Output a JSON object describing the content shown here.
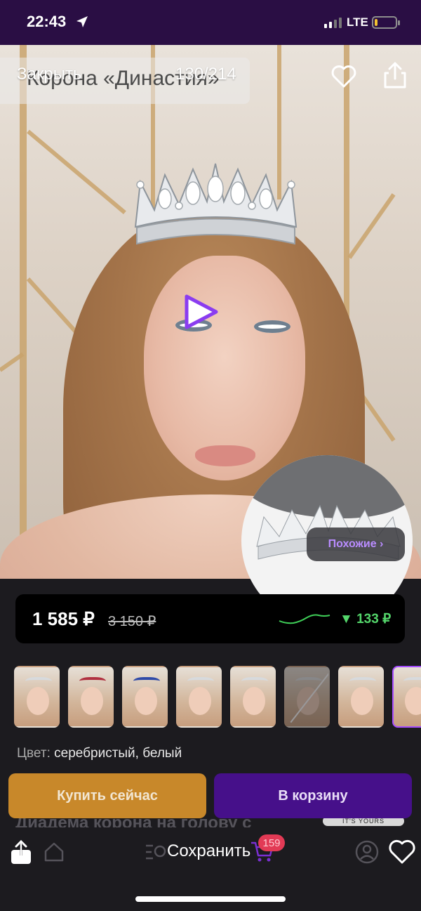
{
  "status_bar": {
    "time": "22:43",
    "network": "LTE",
    "battery_level": 0.15
  },
  "photo": {
    "title": "Корона «Династия»",
    "close_label": "Закрыть",
    "counter": "130/214",
    "similar_label": "Похожие ›"
  },
  "price": {
    "current": "1 585 ₽",
    "old": "3 150 ₽",
    "drop": "▼ 133 ₽",
    "trend_color": "#54d66b"
  },
  "thumbnails": {
    "count": 8,
    "selected_index": 7,
    "faded_index": 5,
    "crown_colors": [
      "#d7dadd",
      "#b03040",
      "#2f4aa8",
      "#d7dadd",
      "#d7dadd",
      "#e0e0e0",
      "#d7dadd",
      "#d7dadd"
    ]
  },
  "color": {
    "label": "Цвет:",
    "value": "серебристый, белый"
  },
  "actions": {
    "buy_now": "Купить сейчас",
    "to_cart": "В корзину"
  },
  "product": {
    "title_partial": "Диадема корона на голову с",
    "brand_tag": "IT'S YOURS"
  },
  "bottom_bar": {
    "save_label": "Сохранить",
    "cart_badge": "159"
  },
  "colors": {
    "accent": "#46108a",
    "buy": "#c8882a",
    "highlight": "#a64dff",
    "status_bar": "#2a0e44"
  }
}
